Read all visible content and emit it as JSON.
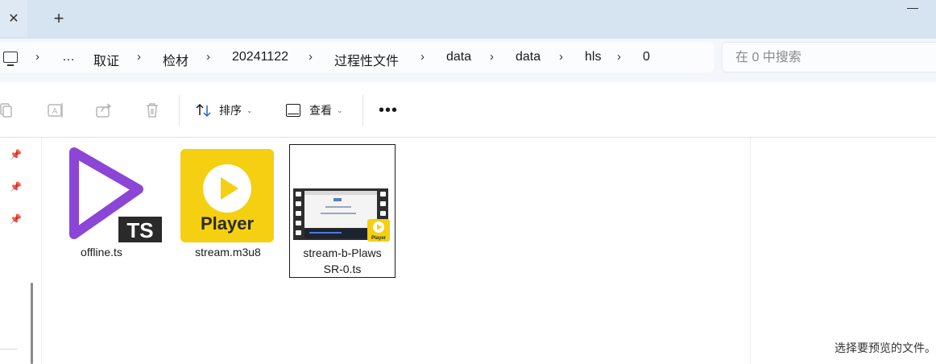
{
  "tabbar": {
    "close_glyph": "✕",
    "new_tab_glyph": "+"
  },
  "address": {
    "crumbs": [
      "…",
      "取证",
      "检材",
      "20241122",
      "过程性文件",
      "data",
      "data",
      "hls",
      "0"
    ],
    "separator": "›"
  },
  "search": {
    "placeholder": "在 0 中搜索"
  },
  "toolbar": {
    "icons": [
      "copy-icon",
      "rename-icon",
      "share-icon",
      "delete-icon"
    ],
    "sort_label": "排序",
    "view_label": "查看",
    "more_label": "•••"
  },
  "files": [
    {
      "name": "offline.ts",
      "icon": "video-play-ts-icon",
      "badge": "TS"
    },
    {
      "name": "stream.m3u8",
      "icon": "player-app-icon",
      "badge": "Player"
    },
    {
      "name": "stream-b-PlawsSR-0.ts",
      "name_line1": "stream-b-Plaws",
      "name_line2": "SR-0.ts",
      "icon": "video-thumbnail-icon",
      "badge": "Player",
      "selected": true
    }
  ],
  "preview": {
    "message": "选择要预览的文件。"
  },
  "colors": {
    "tabbar_bg": "#d6e3f0",
    "play_purple": "#8b46d6",
    "player_yellow": "#f5cf11"
  }
}
